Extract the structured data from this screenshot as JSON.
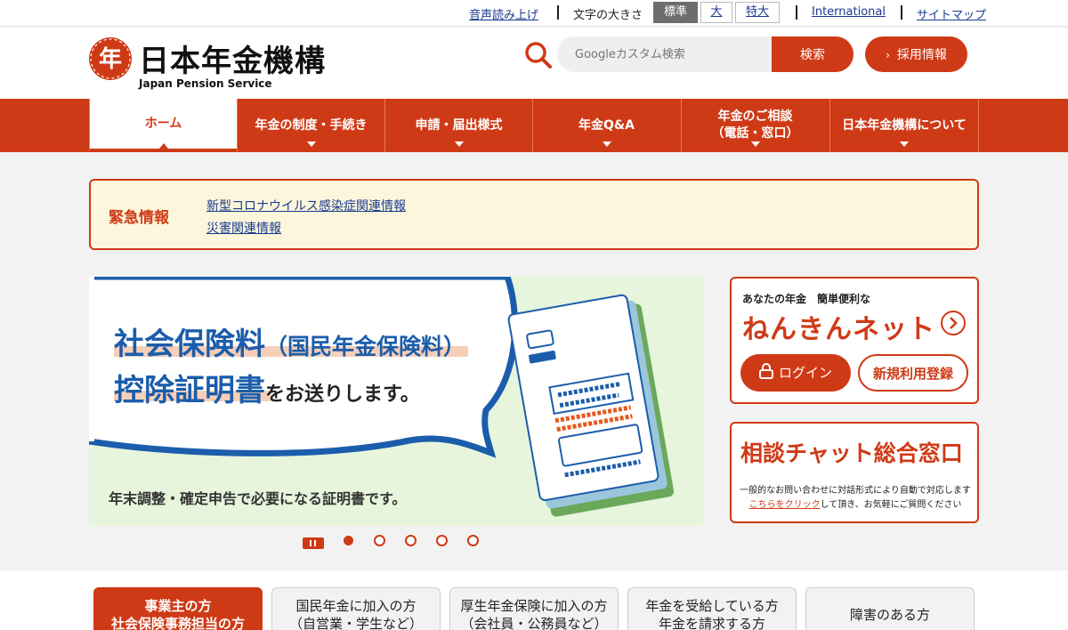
{
  "utility": {
    "read_aloud": "音声読み上げ",
    "font_size_label": "文字の大きさ",
    "font_sizes": [
      "標準",
      "大",
      "特大"
    ],
    "international": "International",
    "sitemap": "サイトマップ"
  },
  "header": {
    "logo_title": "日本年金機構",
    "logo_subtitle": "Japan Pension Service",
    "logo_glyph": "年",
    "search_placeholder": "Googleカスタム検索",
    "search_button": "検索",
    "recruit_button": "採用情報"
  },
  "nav": {
    "items": [
      {
        "label": "ホーム"
      },
      {
        "label": "年金の制度・手続き"
      },
      {
        "label": "申請・届出様式"
      },
      {
        "label": "年金Q&A"
      },
      {
        "label": "年金のご相談",
        "label2": "（電話・窓口）"
      },
      {
        "label": "日本年金機構について"
      }
    ]
  },
  "emergency": {
    "title": "緊急情報",
    "links": [
      "新型コロナウイルス感染症関連情報",
      "災害関連情報"
    ]
  },
  "hero": {
    "line1_main": "社会保険料",
    "line1_paren": "（国民年金保険料）",
    "line2_main": "控除証明書",
    "line2_rest": "をお送りします。",
    "caption": "年末調整・確定申告で必要になる証明書です。"
  },
  "carousel": {
    "slides": 5,
    "active_index": 0
  },
  "nenkin_net": {
    "lead": "あなたの年金　簡単便利な",
    "title": "ねんきんネット",
    "login": "ログイン",
    "register": "新規利用登録"
  },
  "chat": {
    "title": "相談チャット総合窓口",
    "desc1": "一般的なお問い合わせに対話形式により自動で対応します",
    "desc_link": "こちらをクリック",
    "desc2": "して頂き、お気軽にご質問ください"
  },
  "tabs": [
    {
      "line1": "事業主の方",
      "line2": "社会保険事務担当の方"
    },
    {
      "line1": "国民年金に加入の方",
      "line2": "（自営業・学生など）"
    },
    {
      "line1": "厚生年金保険に加入の方",
      "line2": "（会社員・公務員など）"
    },
    {
      "line1": "年金を受給している方",
      "line2": "年金を請求する方"
    },
    {
      "line1": "障害のある方",
      "line2": ""
    }
  ],
  "colors": {
    "brand": "#cf3a16",
    "link": "#1a3a8f",
    "hero_blue": "#1b5dab"
  }
}
